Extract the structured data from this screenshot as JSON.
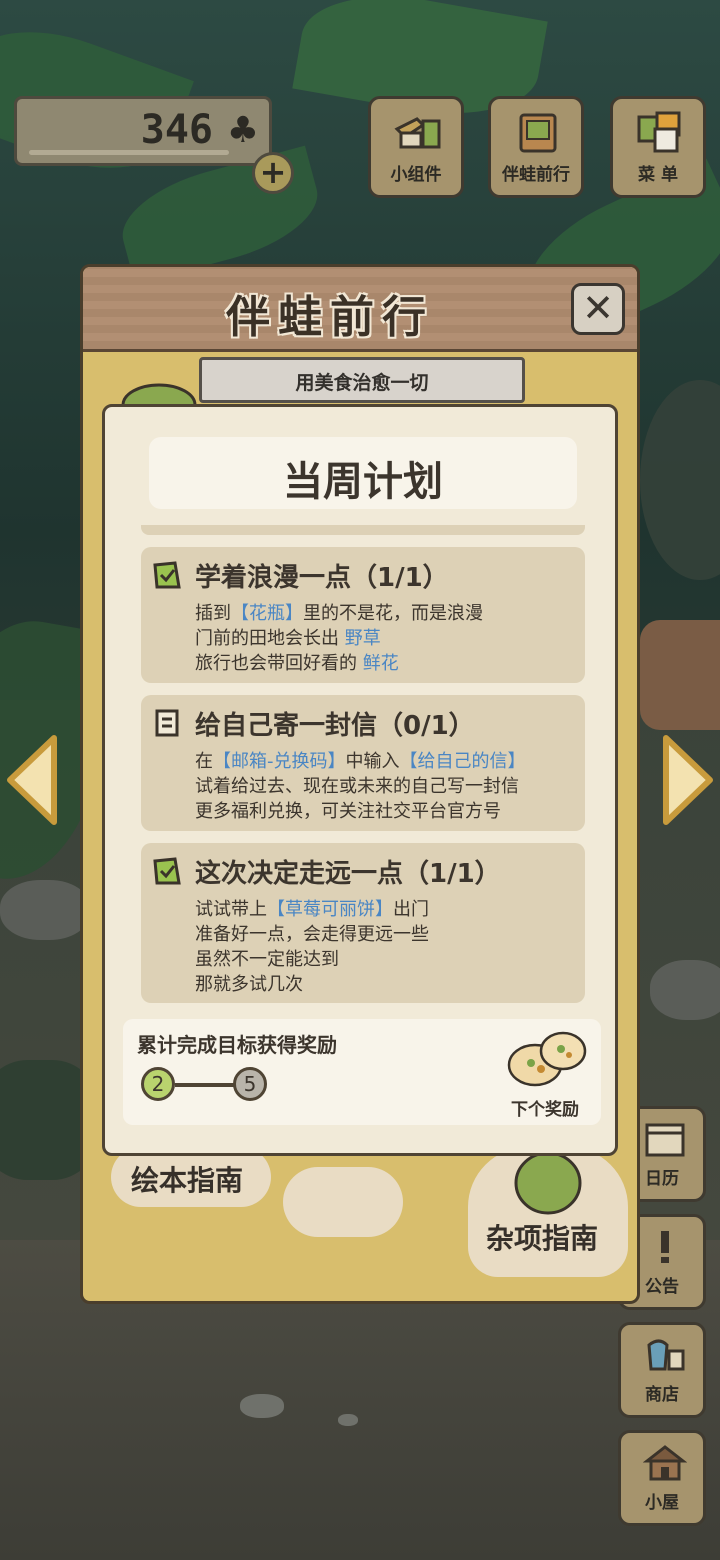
{
  "hud": {
    "clover_count": "346",
    "clover_icon": "clover-icon",
    "add_icon": "+"
  },
  "top_buttons": [
    {
      "label": "小组件",
      "icon": "widget-icon"
    },
    {
      "label": "伴蛙前行",
      "icon": "journey-icon"
    },
    {
      "label": "菜 单",
      "icon": "menu-icon"
    }
  ],
  "side_buttons": [
    {
      "label": "日历",
      "icon": "calendar-icon"
    },
    {
      "label": "公告",
      "icon": "notice-icon"
    },
    {
      "label": "商店",
      "icon": "shop-icon"
    },
    {
      "label": "小屋",
      "icon": "house-icon"
    }
  ],
  "panel": {
    "title": "伴蛙前行",
    "close_icon": "✕",
    "banner": "用美食治愈一切",
    "guides": [
      "绘本指南",
      "杂项指南"
    ]
  },
  "weekly": {
    "title": "当周计划",
    "tasks": [
      {
        "title": "学着浪漫一点（1/1）",
        "status": "done",
        "lines": [
          {
            "pre": "插到",
            "hl": "【花瓶】",
            "mid": "里的不是花，而是浪漫",
            "hl2": "",
            "post": ""
          },
          {
            "pre": "门前的田地会长出 ",
            "hl": "野草",
            "mid": "",
            "hl2": "",
            "post": ""
          },
          {
            "pre": "旅行也会带回好看的 ",
            "hl": "鲜花",
            "mid": "",
            "hl2": "",
            "post": ""
          }
        ]
      },
      {
        "title": "给自己寄一封信（0/1）",
        "status": "pending",
        "lines": [
          {
            "pre": "在",
            "hl": "【邮箱-兑换码】",
            "mid": "中输入",
            "hl2": "【给自己的信】",
            "post": ""
          },
          {
            "pre": "试着给过去、现在或未来的自己写一封信",
            "hl": "",
            "mid": "",
            "hl2": "",
            "post": ""
          },
          {
            "pre": "更多福利兑换，可关注社交平台官方号",
            "hl": "",
            "mid": "",
            "hl2": "",
            "post": ""
          }
        ]
      },
      {
        "title": "这次决定走远一点（1/1）",
        "status": "done",
        "lines": [
          {
            "pre": "试试带上",
            "hl": "【草莓可丽饼】",
            "mid": "出门",
            "hl2": "",
            "post": ""
          },
          {
            "pre": "准备好一点，会走得更远一些",
            "hl": "",
            "mid": "",
            "hl2": "",
            "post": ""
          },
          {
            "pre": "虽然不一定能达到",
            "hl": "",
            "mid": "",
            "hl2": "",
            "post": ""
          },
          {
            "pre": "那就多试几次",
            "hl": "",
            "mid": "",
            "hl2": "",
            "post": ""
          }
        ]
      }
    ],
    "reward": {
      "title": "累计完成目标获得奖励",
      "current": "2",
      "target": "5",
      "next_label": "下个奖励",
      "reward_icon": "dumpling-icon"
    }
  },
  "colors": {
    "panel": "#d8be6d",
    "card": "#f1ead8",
    "task_bg": "#ddd1b6",
    "highlight": "#4a86c4",
    "done_icon": "#9ac34f",
    "progress_current": "#b9d36e",
    "progress_target": "#b9b4aa"
  }
}
